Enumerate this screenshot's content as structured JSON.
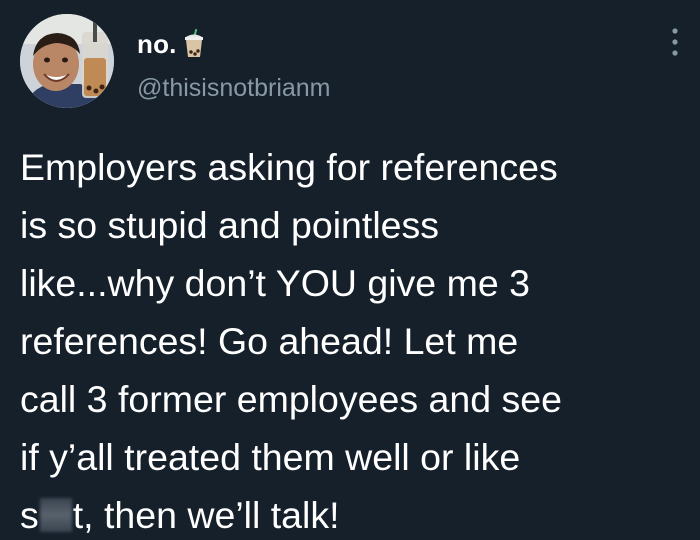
{
  "author": {
    "display_name": "no.",
    "handle": "@thisisnotbrianm",
    "name_emoji": "bubble-tea-icon",
    "avatar": "profile-photo-avatar"
  },
  "menu_icon": "more-options-icon",
  "tweet": {
    "lines": [
      "Employers asking for references",
      "is so stupid and pointless",
      "like...why don’t YOU give me 3",
      "references! Go ahead! Let me",
      "call 3 former employees and see",
      "if y’all treated them well or like"
    ],
    "last_line_start": "s",
    "last_line_end": "t, then we’ll talk!",
    "censored_segment": "blurred-letters"
  },
  "colors": {
    "background": "#15202b",
    "text": "#ffffff",
    "secondary_text": "#8899a6"
  }
}
